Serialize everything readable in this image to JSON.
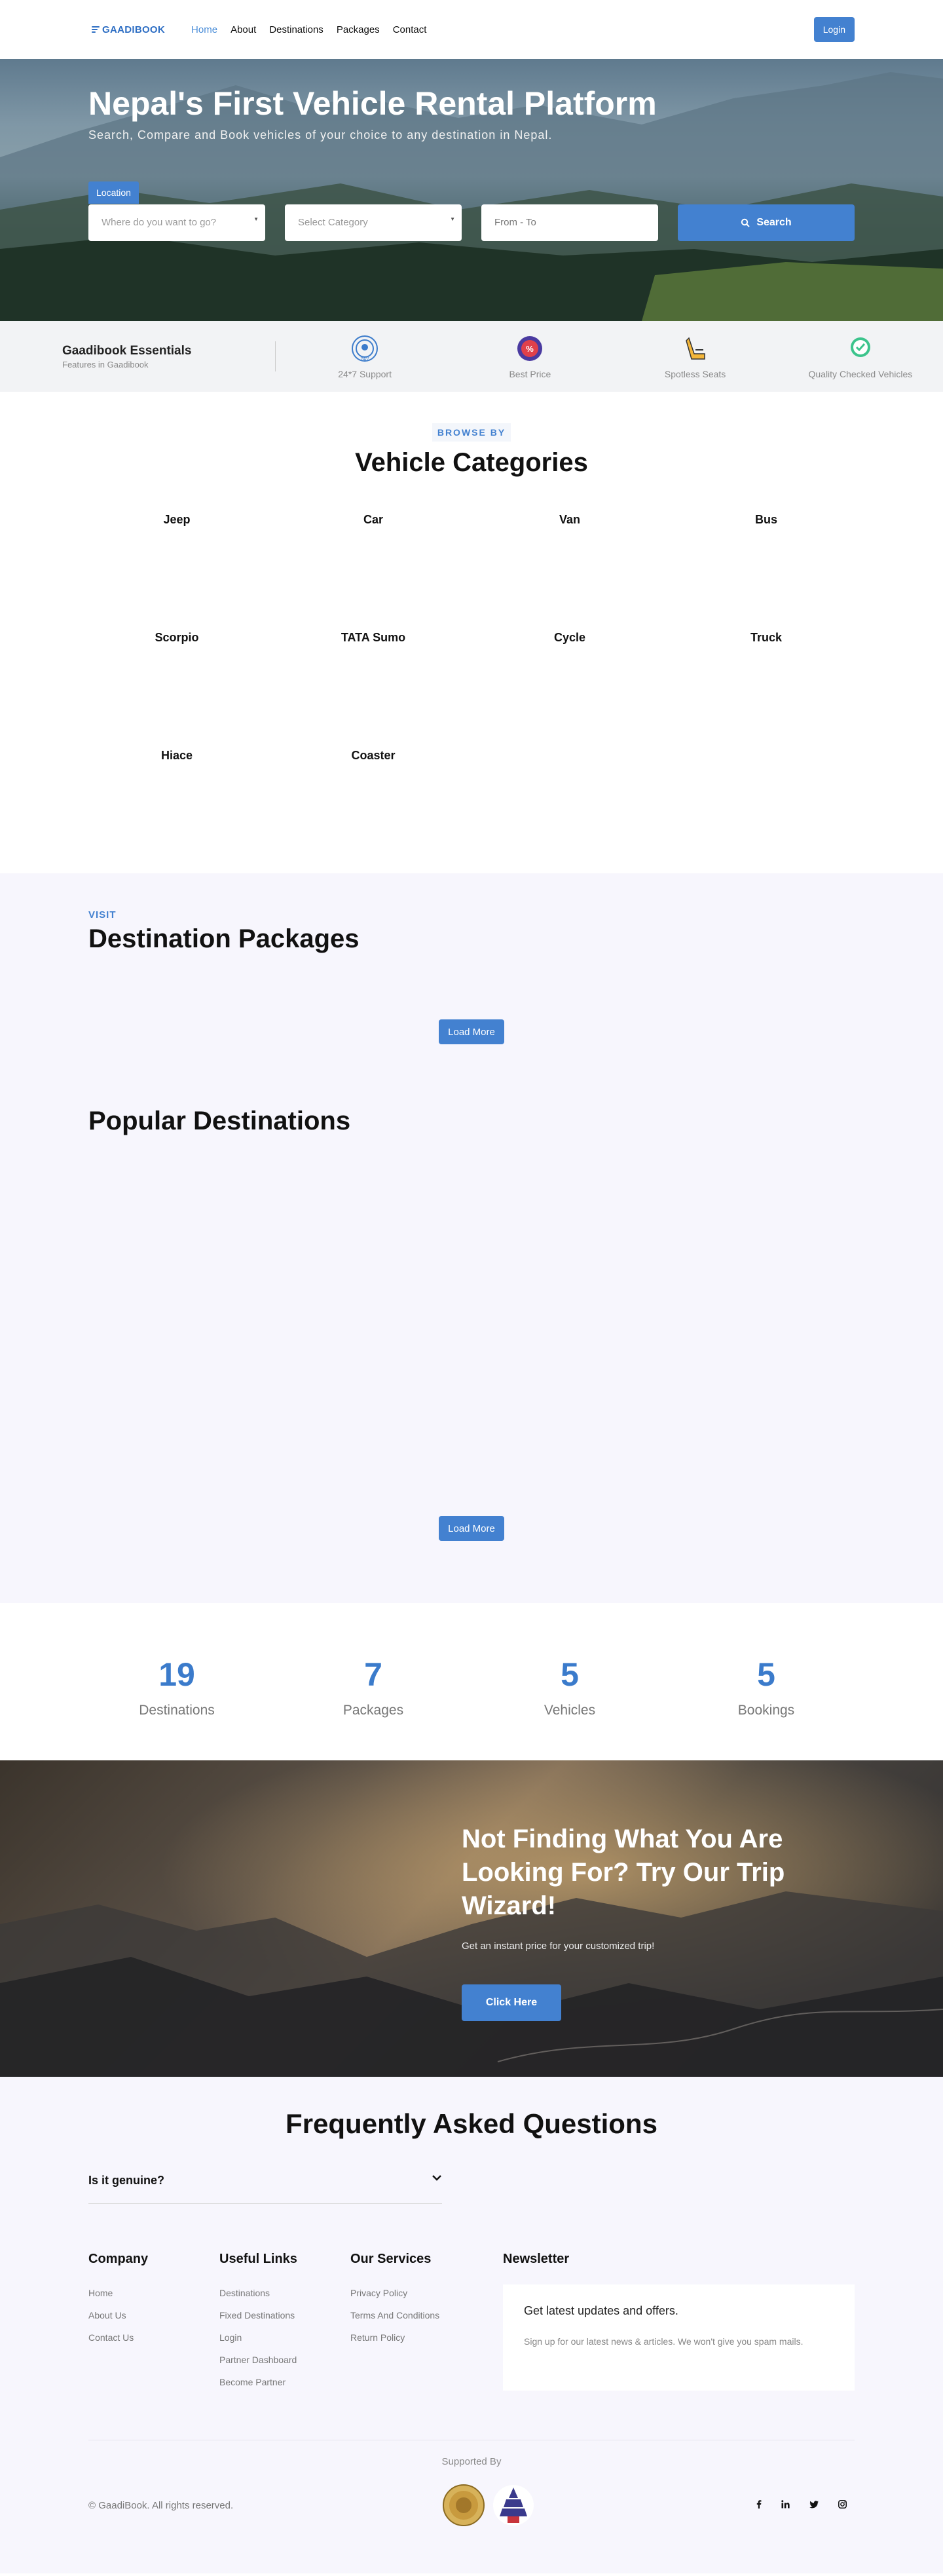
{
  "nav": {
    "brand": "GAADIBOOK",
    "links": [
      "Home",
      "About",
      "Destinations",
      "Packages",
      "Contact"
    ],
    "login": "Login"
  },
  "hero": {
    "title": "Nepal's First Vehicle Rental Platform",
    "subtitle": "Search, Compare and Book vehicles of your choice to any destination in Nepal.",
    "tab": "Location",
    "where_placeholder": "Where do you want to go?",
    "category_placeholder": "Select Category",
    "date_placeholder": "From - To",
    "search": "Search"
  },
  "essentials": {
    "title": "Gaadibook Essentials",
    "subtitle": "Features in Gaadibook",
    "items": [
      "24*7 Support",
      "Best Price",
      "Spotless Seats",
      "Quality Checked Vehicles"
    ]
  },
  "categories": {
    "eyebrow": "BROWSE BY",
    "title": "Vehicle Categories",
    "items": [
      "Jeep",
      "Car",
      "Van",
      "Bus",
      "Scorpio",
      "TATA Sumo",
      "Cycle",
      "Truck",
      "Hiace",
      "Coaster"
    ]
  },
  "packages": {
    "eyebrow": "VISIT",
    "title": "Destination Packages",
    "load_more": "Load More",
    "popular_title": "Popular Destinations"
  },
  "stats": [
    {
      "value": "19",
      "label": "Destinations"
    },
    {
      "value": "7",
      "label": "Packages"
    },
    {
      "value": "5",
      "label": "Vehicles"
    },
    {
      "value": "5",
      "label": "Bookings"
    }
  ],
  "trip": {
    "title": "Not Finding What You Are Looking For? Try Our Trip Wizard!",
    "subtitle": "Get an instant price for your customized trip!",
    "cta": "Click Here"
  },
  "faq": {
    "title": "Frequently Asked Questions",
    "items": [
      "Is it genuine?"
    ]
  },
  "footer": {
    "company": {
      "title": "Company",
      "links": [
        "Home",
        "About Us",
        "Contact Us"
      ]
    },
    "useful": {
      "title": "Useful Links",
      "links": [
        "Destinations",
        "Fixed Destinations",
        "Login",
        "Partner Dashboard",
        "Become Partner"
      ]
    },
    "services": {
      "title": "Our Services",
      "links": [
        "Privacy Policy",
        "Terms And Conditions",
        "Return Policy"
      ]
    },
    "newsletter": {
      "title": "Newsletter",
      "heading": "Get latest updates and offers.",
      "text": "Sign up for our latest news & articles. We won't give you spam mails."
    },
    "supported_by": "Supported By",
    "copyright": "© GaadiBook. All rights reserved.",
    "socials": [
      "f",
      "in",
      "t",
      "ig"
    ]
  },
  "colors": {
    "accent": "#4381d0",
    "page_bg": "#f7f6fd",
    "essentials_bg": "#f2f3f5"
  }
}
